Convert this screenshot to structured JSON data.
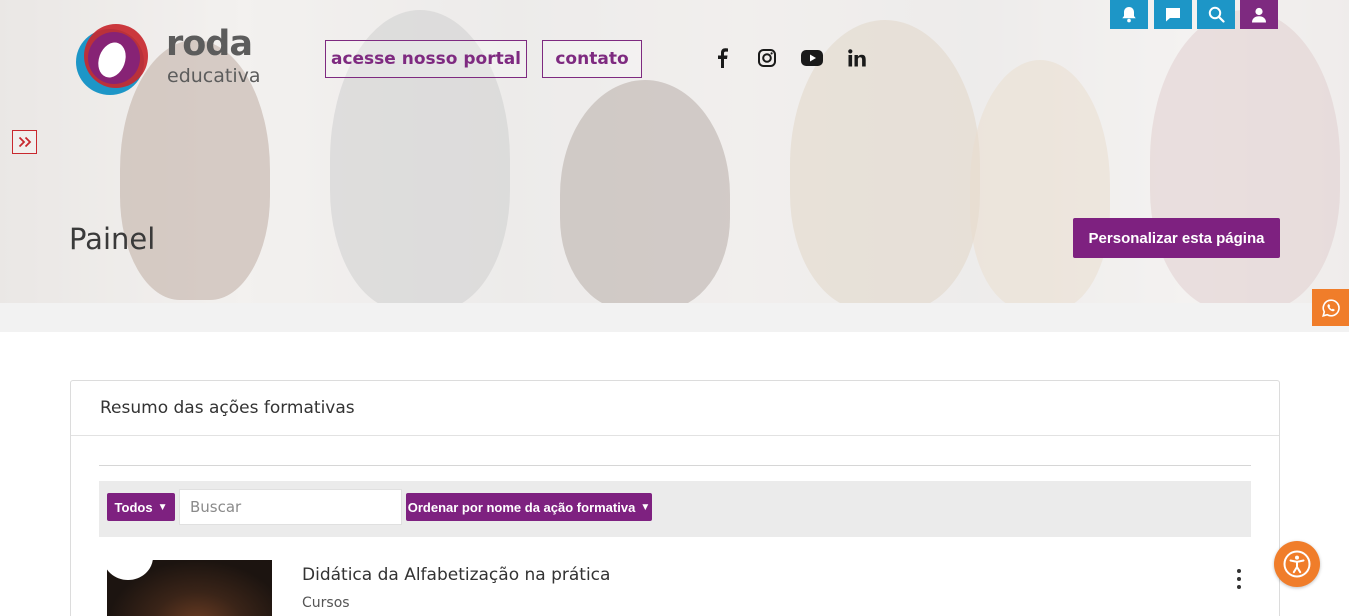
{
  "brand": {
    "word": "roda",
    "sub": "educativa"
  },
  "nav": {
    "portal_label": "acesse nosso portal",
    "contato_label": "contato"
  },
  "social": [
    "facebook-icon",
    "instagram-icon",
    "youtube-icon",
    "linkedin-icon"
  ],
  "topbar": {
    "icons": [
      "bell-icon",
      "chat-icon",
      "search-icon",
      "user-icon"
    ],
    "accent": "#1d96c7",
    "user_color": "#7e2a80"
  },
  "page": {
    "title": "Painel",
    "customize_label": "Personalizar esta página"
  },
  "card": {
    "title": "Resumo das ações formativas",
    "filter": {
      "todos_label": "Todos",
      "search_placeholder": "Buscar",
      "sort_label": "Ordenar por nome da ação formativa"
    },
    "courses": [
      {
        "title": "Didática da Alfabetização na prática",
        "category": "Cursos"
      }
    ]
  },
  "colors": {
    "primary": "#7e2180",
    "whatsapp": "#f07d2a",
    "accessibility": "#f07d2a"
  }
}
